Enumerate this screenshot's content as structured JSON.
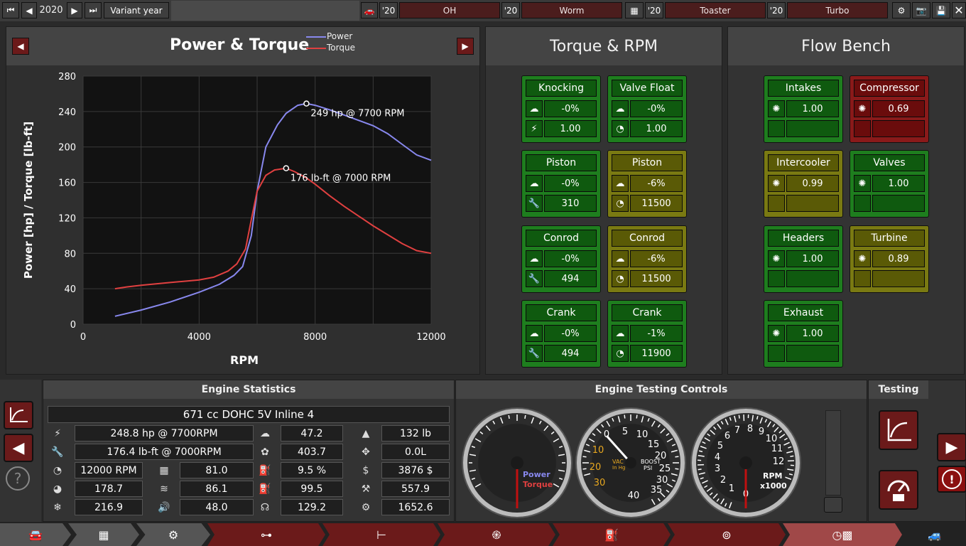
{
  "topbar": {
    "year": "2020",
    "variant_button": "Variant year",
    "model_year": "'20",
    "model_name": "OH",
    "trim_year": "'20",
    "trim_name": "Worm",
    "family_year": "'20",
    "family_name": "Toaster",
    "variant_year": "'20",
    "variant_name": "Turbo"
  },
  "chart_panel": {
    "legend_power": "Power",
    "legend_torque": "Torque"
  },
  "chart_data": {
    "type": "line",
    "title": "Power & Torque",
    "xlabel": "RPM",
    "ylabel": "Power [hp] / Torque [lb-ft]",
    "xlim": [
      0,
      12000
    ],
    "ylim": [
      0,
      280
    ],
    "xticks": [
      "0",
      "4000",
      "8000",
      "12000"
    ],
    "yticks": [
      "0",
      "40",
      "80",
      "120",
      "160",
      "200",
      "240",
      "280"
    ],
    "grid": true,
    "legend": "top",
    "colors": {
      "power": "#8888ee",
      "torque": "#e04040"
    },
    "series": [
      {
        "name": "Power",
        "x": [
          1100,
          2000,
          3000,
          4000,
          4700,
          5200,
          5500,
          5800,
          6000,
          6300,
          6700,
          7000,
          7400,
          7700,
          8000,
          8500,
          9000,
          9500,
          10000,
          10500,
          11000,
          11500,
          12000
        ],
        "y": [
          9,
          16,
          25,
          36,
          45,
          55,
          65,
          100,
          150,
          200,
          225,
          238,
          247,
          249,
          247,
          242,
          236,
          230,
          224,
          215,
          203,
          191,
          185
        ]
      },
      {
        "name": "Torque",
        "x": [
          1100,
          1500,
          2000,
          3000,
          4000,
          4500,
          5000,
          5300,
          5600,
          5800,
          6000,
          6300,
          6600,
          7000,
          7300,
          7700,
          8000,
          8500,
          9000,
          9500,
          10000,
          10500,
          11000,
          11500,
          12000
        ],
        "y": [
          40,
          42,
          44,
          47,
          50,
          53,
          60,
          68,
          85,
          118,
          150,
          168,
          174,
          176,
          172,
          165,
          158,
          145,
          133,
          122,
          111,
          101,
          91,
          83,
          80
        ]
      }
    ],
    "annotations": [
      {
        "text": "249 hp @ 7700 RPM",
        "x": 7700,
        "y": 249
      },
      {
        "text": "176 lb-ft @ 7000 RPM",
        "x": 7000,
        "y": 176
      }
    ]
  },
  "torque_panel": {
    "title": "Torque & RPM",
    "cards": [
      {
        "title": "Knocking",
        "v1": "-0%",
        "v2": "1.00",
        "c": "g",
        "i2": "bolt"
      },
      {
        "title": "Valve Float",
        "v1": "-0%",
        "v2": "1.00",
        "c": "g",
        "i2": "gauge"
      },
      {
        "title": "Piston",
        "v1": "-0%",
        "v2": "310",
        "c": "g",
        "i2": "wrench"
      },
      {
        "title": "Piston",
        "v1": "-6%",
        "v2": "11500",
        "c": "y",
        "i2": "gauge"
      },
      {
        "title": "Conrod",
        "v1": "-0%",
        "v2": "494",
        "c": "g",
        "i2": "wrench"
      },
      {
        "title": "Conrod",
        "v1": "-6%",
        "v2": "11500",
        "c": "y",
        "i2": "gauge"
      },
      {
        "title": "Crank",
        "v1": "-0%",
        "v2": "494",
        "c": "g",
        "i2": "wrench"
      },
      {
        "title": "Crank",
        "v1": "-1%",
        "v2": "11900",
        "c": "g",
        "i2": "gauge"
      }
    ]
  },
  "flow_panel": {
    "title": "Flow Bench",
    "cards": [
      {
        "title": "Intakes",
        "v1": "1.00",
        "c": "g"
      },
      {
        "title": "Compressor",
        "v1": "0.69",
        "c": "r"
      },
      {
        "title": "Intercooler",
        "v1": "0.99",
        "c": "y"
      },
      {
        "title": "Valves",
        "v1": "1.00",
        "c": "g"
      },
      {
        "title": "Headers",
        "v1": "1.00",
        "c": "g"
      },
      {
        "title": "Turbine",
        "v1": "0.89",
        "c": "y"
      },
      {
        "title": "Exhaust",
        "v1": "1.00",
        "c": "g"
      }
    ]
  },
  "stats": {
    "header": "Engine Statistics",
    "engine": "671 cc DOHC 5V Inline 4",
    "power": "248.8 hp @ 7700RPM",
    "torque": "176.4 lb-ft @ 7000RPM",
    "rpm": "12000 RPM",
    "s_a": "81.0",
    "s_b": "178.7",
    "s_c": "86.1",
    "s_d": "216.9",
    "s_e": "48.0",
    "m1": "47.2",
    "m2": "403.7",
    "m3": "9.5 %",
    "m4": "99.5",
    "m5": "129.2",
    "r1": "132 lb",
    "r2": "0.0L",
    "r3": "3876 $",
    "r4": "557.9",
    "r5": "1652.6"
  },
  "testing": {
    "header": "Engine Testing Controls",
    "side_header": "Testing",
    "g1_power": "Power",
    "g1_torque": "Torque",
    "g2_vac": "VAC",
    "g2_inhg": "In Hg",
    "g2_boost": "BOOST",
    "g2_psi": "PSI",
    "g2_nums": [
      "0",
      "5",
      "10",
      "15",
      "20",
      "25",
      "30",
      "35",
      "40",
      "10",
      "20",
      "30"
    ],
    "g3_nums": [
      "0",
      "1",
      "2",
      "3",
      "4",
      "5",
      "6",
      "7",
      "8",
      "9",
      "10",
      "11",
      "12"
    ],
    "g3_rpm": "RPM",
    "g3_x": "x1000"
  },
  "colors": {
    "green": "#1e7e1e",
    "yellow": "#7a7a12",
    "red": "#8a1a1a",
    "power": "#8888ee",
    "torque": "#e04040"
  }
}
